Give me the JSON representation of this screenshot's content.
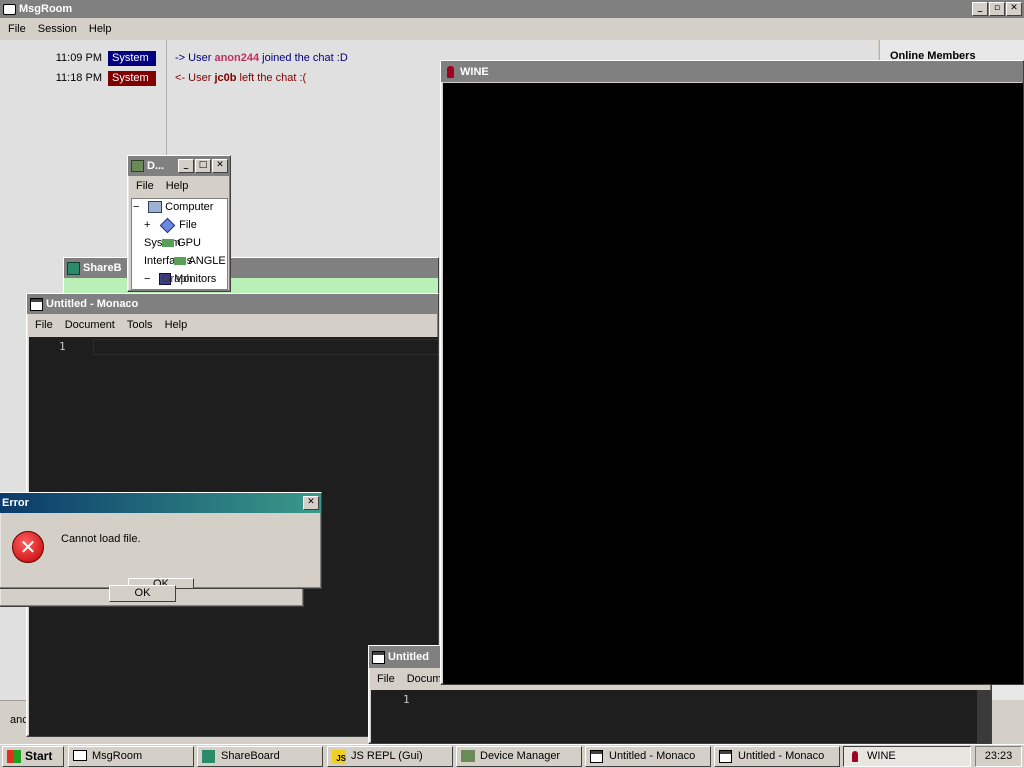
{
  "msgroom": {
    "title": "MsgRoom",
    "menu": [
      "File",
      "Session",
      "Help"
    ],
    "messages": [
      {
        "time": "11:09 PM",
        "badge": "System",
        "badge_color": "#000080",
        "arrow": "->",
        "pre": "User",
        "user": "anon244",
        "post": "joined the chat :D",
        "text_color": "#000080",
        "user_color": "#c03060"
      },
      {
        "time": "11:18 PM",
        "badge": "System",
        "badge_color": "#800000",
        "arrow": "<-",
        "pre": "User",
        "user": "jc0b",
        "post": "left the chat :(",
        "text_color": "#800000",
        "user_color": "#800000"
      }
    ],
    "members_title": "Online Members",
    "input_partial": "anc"
  },
  "device_manager": {
    "title": "D...",
    "menu": [
      "File",
      "Help"
    ],
    "tree": [
      {
        "prefix": "−",
        "label": "Computer"
      },
      {
        "prefix": "+",
        "label": "File"
      },
      {
        "prefix": "",
        "label": "System"
      },
      {
        "prefix": "",
        "label": "GPU"
      },
      {
        "prefix": "",
        "label": "Interfaces"
      },
      {
        "prefix": "",
        "label": "ANGLE"
      },
      {
        "prefix": "−",
        "label": "Monitors"
      },
      {
        "prefix": "",
        "label": "Graph"
      }
    ]
  },
  "shareboard": {
    "title": "ShareB"
  },
  "monaco1": {
    "title": "Untitled - Monaco",
    "menu": [
      "File",
      "Document",
      "Tools",
      "Help"
    ],
    "line_number": "1"
  },
  "monaco2": {
    "title": "Untitled",
    "menu": [
      "File",
      "Docume"
    ],
    "line_number": "1"
  },
  "error": {
    "title": "Error",
    "message": "Cannot load file.",
    "ok_label": "OK",
    "ok_ghost_label": "OK"
  },
  "wine": {
    "title": "WINE"
  },
  "taskbar": {
    "start_label": "Start",
    "items": [
      {
        "label": "MsgRoom",
        "icon": "chat-icon"
      },
      {
        "label": "ShareBoard",
        "icon": "shareboard-icon"
      },
      {
        "label": "JS REPL (Gui)",
        "icon": "js-icon"
      },
      {
        "label": "Device Manager",
        "icon": "device-manager-icon"
      },
      {
        "label": "Untitled - Monaco",
        "icon": "monaco-icon"
      },
      {
        "label": "Untitled - Monaco",
        "icon": "monaco-icon"
      },
      {
        "label": "WINE",
        "icon": "wine-icon"
      }
    ],
    "clock": "23:23"
  },
  "colors": {
    "active_title": "#0a246a",
    "inactive_title": "#808080",
    "editor_bg": "#1e1e1e",
    "wine_bg": "#000000",
    "shareboard_green": "#b8f0b8"
  }
}
